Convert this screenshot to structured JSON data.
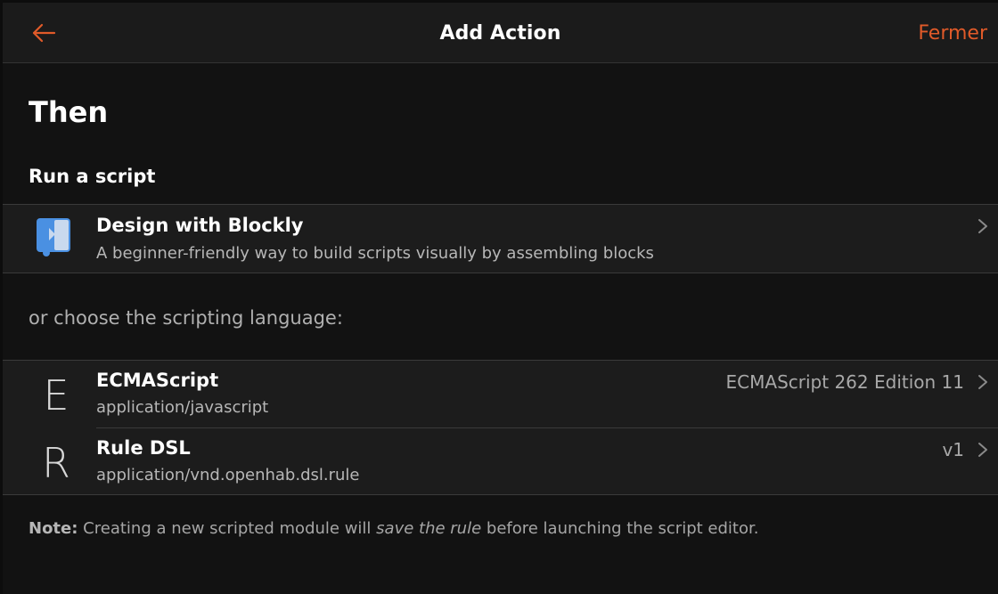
{
  "navbar": {
    "back_icon": "arrow-left-icon",
    "title": "Add Action",
    "close_label": "Fermer"
  },
  "block_title": "Then",
  "section_title": "Run a script",
  "blockly": {
    "icon": "blockly-icon",
    "title": "Design with Blockly",
    "subtitle": "A beginner-friendly way to build scripts visually by assembling blocks"
  },
  "languages_intro": "or choose the scripting language:",
  "languages": [
    {
      "letter": "E",
      "title": "ECMAScript",
      "subtitle": "application/javascript",
      "after": "ECMAScript 262 Edition 11"
    },
    {
      "letter": "R",
      "title": "Rule DSL",
      "subtitle": "application/vnd.openhab.dsl.rule",
      "after": "v1"
    }
  ],
  "note": {
    "label": "Note:",
    "text_before": " Creating a new scripted module will ",
    "emphasis": "save the rule",
    "text_after": " before launching the script editor."
  },
  "colors": {
    "accent": "#e05a29",
    "background": "#121212",
    "list_background": "#1c1c1c",
    "blockly_blue": "#4a90e2"
  }
}
